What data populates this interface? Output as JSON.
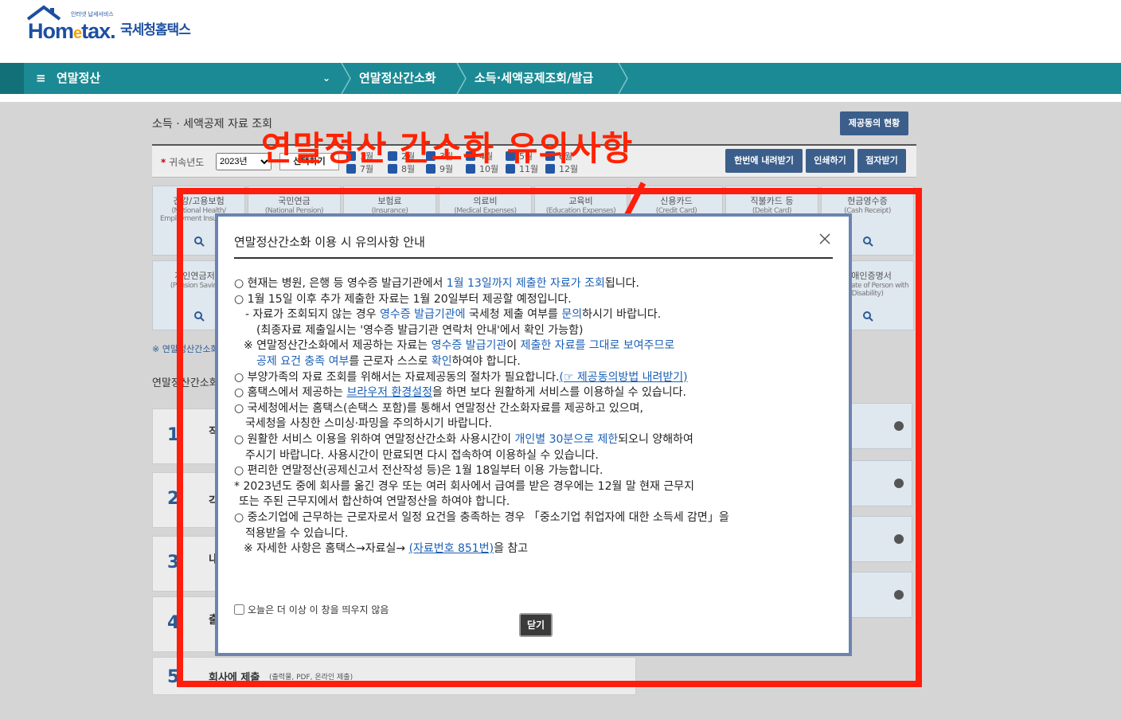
{
  "header": {
    "logo_word": "Hom",
    "logo_e": "e",
    "logo_word2": "tax.",
    "logo_tagline": "인터넷 납세서비스",
    "logo_kr": "국세청홈택스"
  },
  "nav": {
    "menu": "연말정산",
    "crumb1": "연말정산간소화",
    "crumb2": "소득·세액공제조회/발급"
  },
  "background": {
    "section_title": "소득 · 세액공제 자료 조회",
    "consent_status_btn": "제공동의 현황",
    "year_label": "귀속년도",
    "year_value": "2023년",
    "select_all": "선택하기",
    "months_row1": [
      "1월",
      "2월",
      "3월",
      "4월",
      "5월",
      "6월"
    ],
    "months_row2": [
      "7월",
      "8월",
      "9월",
      "10월",
      "11월",
      "12월"
    ],
    "download_all_btn": "한번에 내려받기",
    "print_btn": "인쇄하기",
    "braille_btn": "점자받기",
    "tiles": [
      {
        "kr": "건강/고용보험",
        "en": "(National Health/ Employment Insurance)"
      },
      {
        "kr": "국민연금",
        "en": "(National Pension)"
      },
      {
        "kr": "보험료",
        "en": "(Insurance)"
      },
      {
        "kr": "의료비",
        "en": "(Medical Expenses)"
      },
      {
        "kr": "교육비",
        "en": "(Education Expenses)"
      },
      {
        "kr": "신용카드",
        "en": "(Credit Card)"
      },
      {
        "kr": "직불카드 등",
        "en": "(Debit Card)"
      },
      {
        "kr": "현금영수증",
        "en": "(Cash Receipt)"
      }
    ],
    "tile_row2_left": {
      "kr": "개인연금저축",
      "en": "(Pension Savings)"
    },
    "tile_row2_right": {
      "kr": "장애인증명서",
      "en": "(Certificate of Person with Disability)"
    },
    "note_link": "※ 연말정산간소화",
    "steps_title": "연말정산간소화",
    "steps": [
      {
        "num": "1",
        "text": "직"
      },
      {
        "num": "2",
        "text": "각"
      },
      {
        "num": "3",
        "text": "내"
      },
      {
        "num": "4",
        "text": "출"
      },
      {
        "num": "5",
        "text": "회사에 제출",
        "sub": "(출력물, PDF, 온라인 제출)"
      }
    ]
  },
  "annotation": {
    "title": "연말정산 간소화 유의사항"
  },
  "modal": {
    "title": "연말정산간소화 이용 시 유의사항 안내",
    "lines": {
      "l1a": "○ 현재는 병원, 은행 등 영수증 발급기관에서 ",
      "l1b": "1월 13일까지 제출한 자료가 조회",
      "l1c": "됩니다.",
      "l2": "○ 1월 15일 이후 추가 제출한 자료는 1월 20일부터 제공할 예정입니다.",
      "l3a": "- 자료가 조회되지 않는 경우 ",
      "l3b": "영수증 발급기관에",
      "l3c": " 국세청 제출 여부를 ",
      "l3d": "문의",
      "l3e": "하시기 바랍니다.",
      "l4": "(최종자료 제출일시는 '영수증 발급기관 연락처 안내'에서 확인 가능함)",
      "l5a": "※ 연말정산간소화에서 제공하는 자료는 ",
      "l5b": "영수증 발급기관",
      "l5c": "이 ",
      "l5d": "제출한 자료를 그대로 보여주므로",
      "l6a": "공제 요건 충족 여부",
      "l6b": "를 근로자 스스로 ",
      "l6c": "확인",
      "l6d": "하여야 합니다.",
      "l7a": "○ 부양가족의 자료 조회를 위해서는 자료제공동의 절차가 필요합니다.",
      "l7b": "(☞ 제공동의방법 내려받기)",
      "l8a": "○ 홈택스에서 제공하는 ",
      "l8b": "브라우저 환경설정",
      "l8c": "을 하면 보다 원활하게 서비스를 이용하실 수 있습니다.",
      "l9": "○ 국세청에서는 홈택스(손택스 포함)를 통해서 연말정산 간소화자료를 제공하고 있으며,",
      "l10": "국세청을 사칭한 스미싱·파밍을 주의하시기 바랍니다.",
      "l11a": "○ 원활한 서비스 이용을 위하여 연말정산간소화 사용시간이 ",
      "l11b": "개인별 30분으로 제한",
      "l11c": "되오니 양해하여",
      "l12": "주시기 바랍니다. 사용시간이 만료되면 다시 접속하여 이용하실 수 있습니다.",
      "l13": "○ 편리한 연말정산(공제신고서 전산작성 등)은 1월 18일부터 이용 가능합니다.",
      "l14": "* 2023년도 중에 회사를 옮긴 경우 또는 여러 회사에서 급여를 받은 경우에는 12월 말 현재 근무지",
      "l15": "또는 주된 근무지에서 합산하여 연말정산을 하여야 합니다.",
      "l16": "○ 중소기업에 근무하는 근로자로서 일정 요건을 충족하는 경우 「중소기업 취업자에 대한 소득세 감면」을",
      "l17": "적용받을 수 있습니다.",
      "l18a": "※ 자세한 사항은 홈택스→자료실→ ",
      "l18b": "(자료번호 851번)",
      "l18c": "을 참고"
    },
    "dont_show_today": "오늘은 더 이상 이 창을 띄우지 않음",
    "close_btn": "닫기"
  },
  "colors": {
    "nav_teal": "#1b8a94",
    "link_blue": "#1a5fb4",
    "annotation_red": "#ff1d0d",
    "modal_border": "#6b84b0"
  }
}
